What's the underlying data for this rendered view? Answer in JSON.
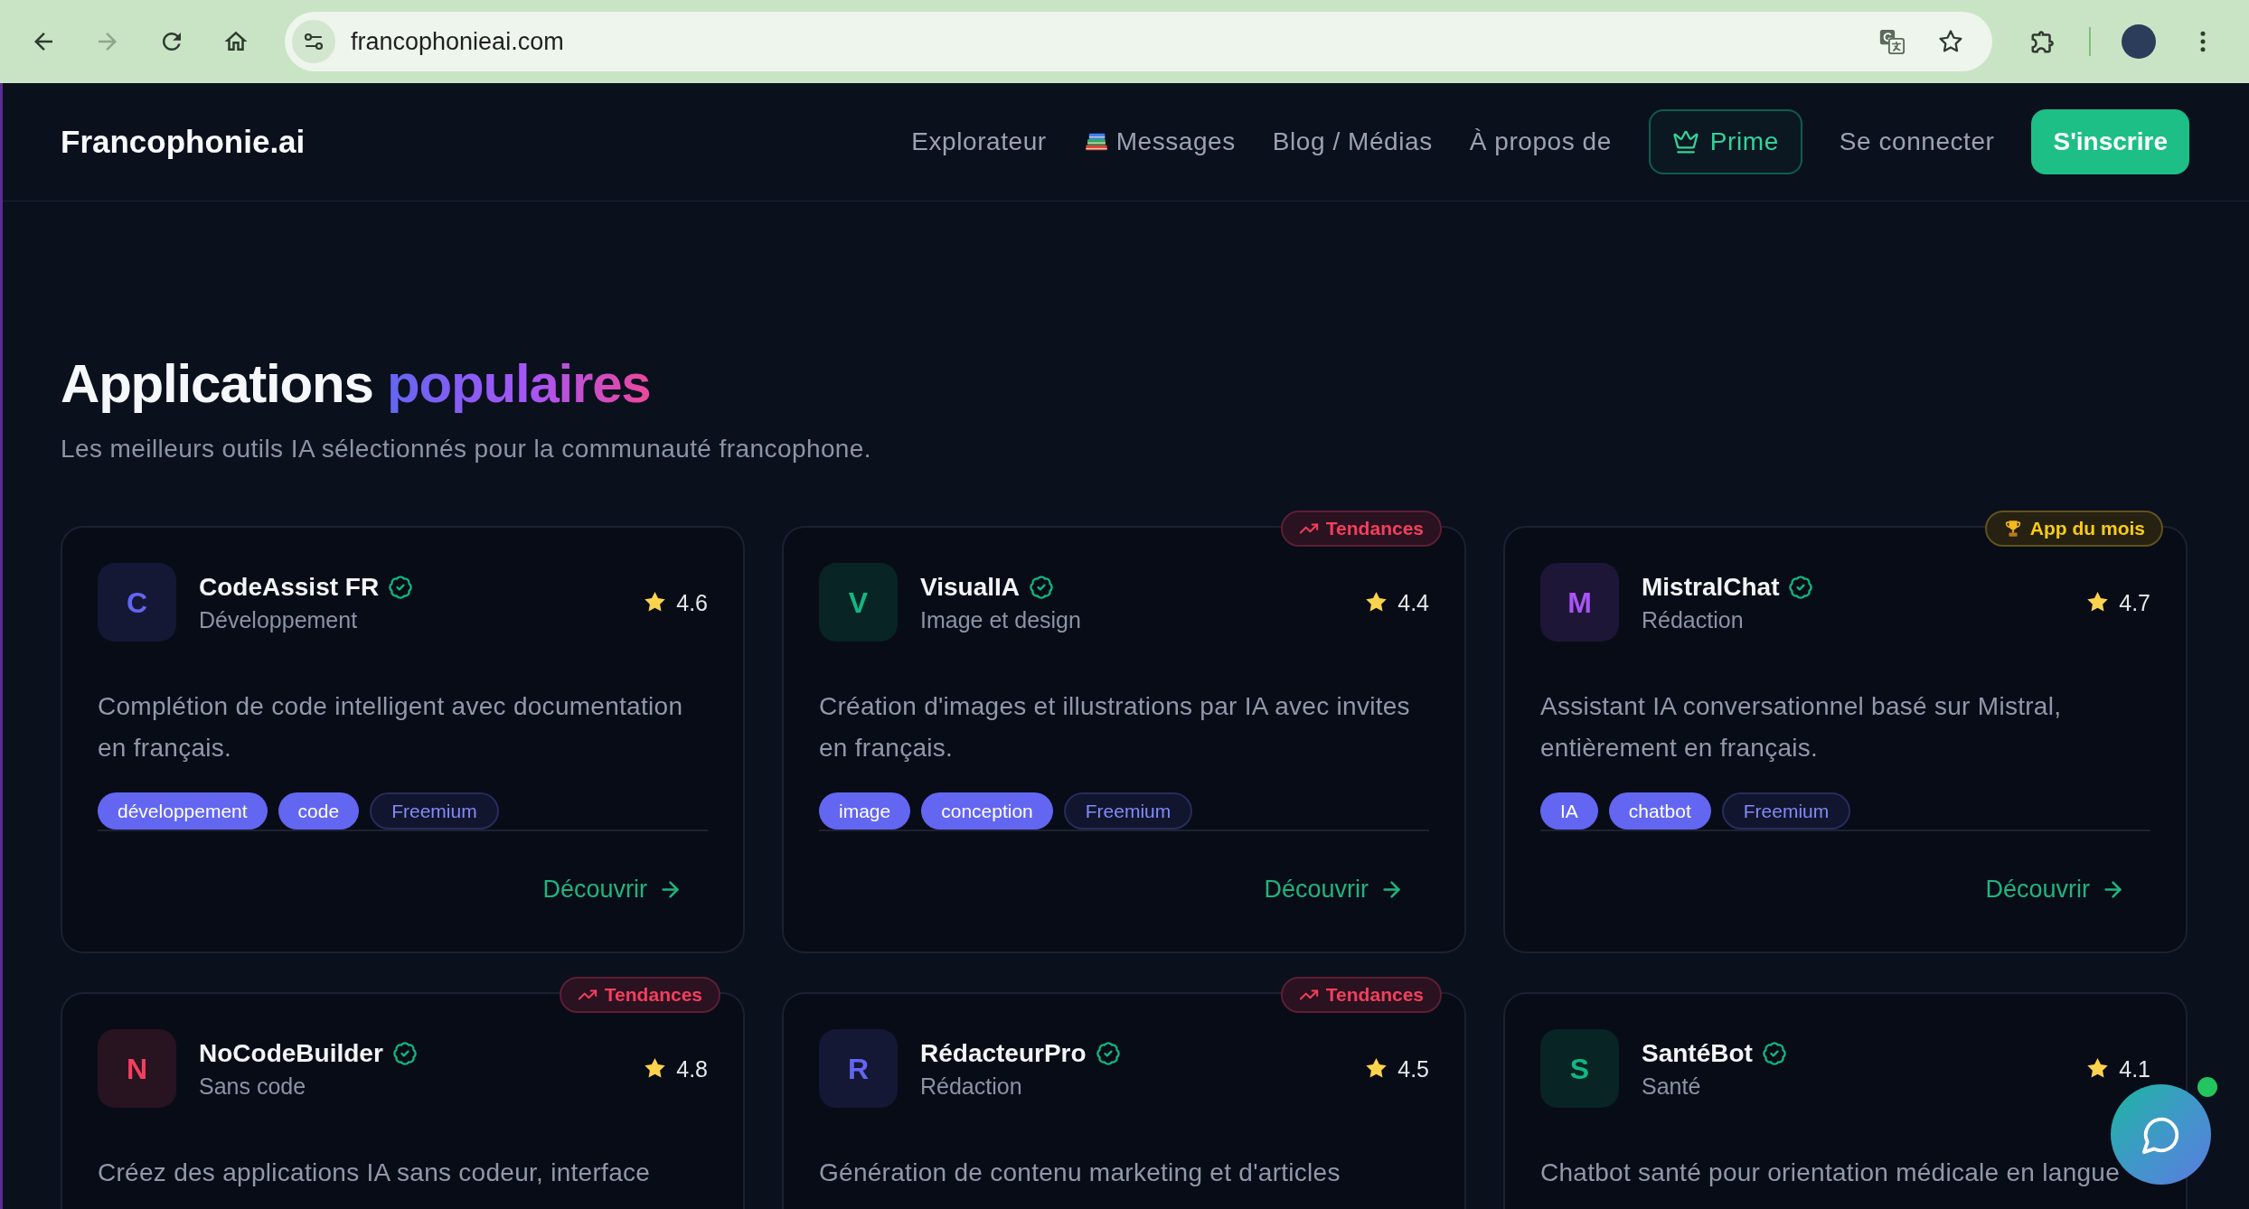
{
  "browser": {
    "url": "francophonieai.com",
    "forward_disabled": true
  },
  "navbar": {
    "brand": "Francophonie.ai",
    "items": [
      {
        "label": "Explorateur",
        "kind": "link"
      },
      {
        "label": "Messages",
        "kind": "emoji-link"
      },
      {
        "label": "Blog / Médias",
        "kind": "link"
      },
      {
        "label": "À propos de",
        "kind": "link"
      },
      {
        "label": "Prime",
        "kind": "premium"
      },
      {
        "label": "Se connecter",
        "kind": "link"
      },
      {
        "label": "S'inscrire",
        "kind": "signup"
      }
    ]
  },
  "section": {
    "title": "Applications",
    "title_accent": "populaires",
    "subtitle": "Les meilleurs outils IA sélectionnés pour la communauté francophone."
  },
  "apps": [
    {
      "initial": "C",
      "color": "#6366f1",
      "name": "CodeAssist FR",
      "verified": true,
      "category": "Développement",
      "rating": "4.6",
      "description": "Complétion de code intelligent avec documentation en français.",
      "tags": [
        {
          "label": "développement",
          "kind": "topic"
        },
        {
          "label": "code",
          "kind": "topic"
        },
        {
          "label": "Freemium",
          "kind": "pricing"
        }
      ],
      "link": "Découvrir"
    },
    {
      "initial": "V",
      "color": "#10b981",
      "name": "VisualIA",
      "verified": true,
      "badge": {
        "kind": "trending",
        "label": "Tendances"
      },
      "category": "Image et design",
      "rating": "4.4",
      "description": "Création d'images et illustrations par IA avec invites en français.",
      "tags": [
        {
          "label": "image",
          "kind": "topic"
        },
        {
          "label": "conception",
          "kind": "topic"
        },
        {
          "label": "Freemium",
          "kind": "pricing"
        }
      ],
      "link": "Découvrir"
    },
    {
      "initial": "M",
      "color": "#a855f7",
      "name": "MistralChat",
      "verified": true,
      "badge": {
        "kind": "award",
        "label": "App du mois"
      },
      "category": "Rédaction",
      "rating": "4.7",
      "description": "Assistant IA conversationnel basé sur Mistral, entièrement en français.",
      "tags": [
        {
          "label": "IA",
          "kind": "topic"
        },
        {
          "label": "chatbot",
          "kind": "topic"
        },
        {
          "label": "Freemium",
          "kind": "pricing"
        }
      ],
      "link": "Découvrir"
    },
    {
      "initial": "N",
      "color": "#f43f5e",
      "name": "NoCodeBuilder",
      "verified": true,
      "badge": {
        "kind": "trending",
        "label": "Tendances"
      },
      "category": "Sans code",
      "rating": "4.8",
      "description": "Créez des applications IA sans codeur, interface"
    },
    {
      "initial": "R",
      "color": "#6366f1",
      "name": "RédacteurPro",
      "verified": true,
      "badge": {
        "kind": "trending",
        "label": "Tendances"
      },
      "category": "Rédaction",
      "rating": "4.5",
      "description": "Génération de contenu marketing et d'articles"
    },
    {
      "initial": "S",
      "color": "#10b981",
      "name": "SantéBot",
      "verified": true,
      "category": "Santé",
      "rating": "4.1",
      "description": "Chatbot santé pour orientation médicale en langue"
    }
  ],
  "chat": {
    "online": true
  }
}
